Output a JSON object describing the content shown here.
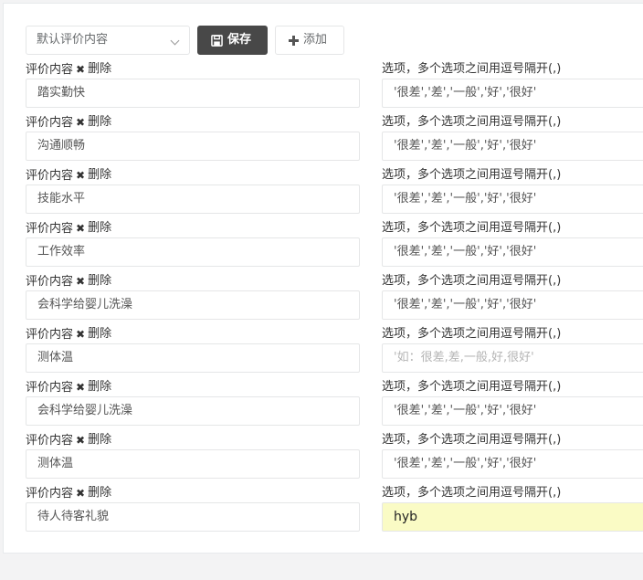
{
  "toolbar": {
    "select_value": "默认评价内容",
    "save_label": "保存",
    "add_label": "添加"
  },
  "labels": {
    "content": "评价内容",
    "delete": "删除",
    "options": "选项，多个选项之间用逗号隔开(,)"
  },
  "items": [
    {
      "content": "踏实勤快",
      "options": "'很差','差','一般','好','很好'",
      "options_placeholder": ""
    },
    {
      "content": "沟通顺畅",
      "options": "'很差','差','一般','好','很好'",
      "options_placeholder": ""
    },
    {
      "content": "技能水平",
      "options": "'很差','差','一般','好','很好'",
      "options_placeholder": ""
    },
    {
      "content": "工作效率",
      "options": "'很差','差','一般','好','很好'",
      "options_placeholder": ""
    },
    {
      "content": "会科学给婴儿洗澡",
      "options": "'很差','差','一般','好','很好'",
      "options_placeholder": ""
    },
    {
      "content": "测体温",
      "options": "",
      "options_placeholder": "'如：很差,差,一般,好,很好'"
    },
    {
      "content": "会科学给婴儿洗澡",
      "options": "'很差','差','一般','好','很好'",
      "options_placeholder": ""
    },
    {
      "content": "测体温",
      "options": "'很差','差','一般','好','很好'",
      "options_placeholder": ""
    },
    {
      "content": "待人待客礼貌",
      "options": "hyb",
      "options_placeholder": ""
    }
  ],
  "colors": {
    "save_bg": "#484848",
    "active_input_bg": "#fafbc5"
  }
}
